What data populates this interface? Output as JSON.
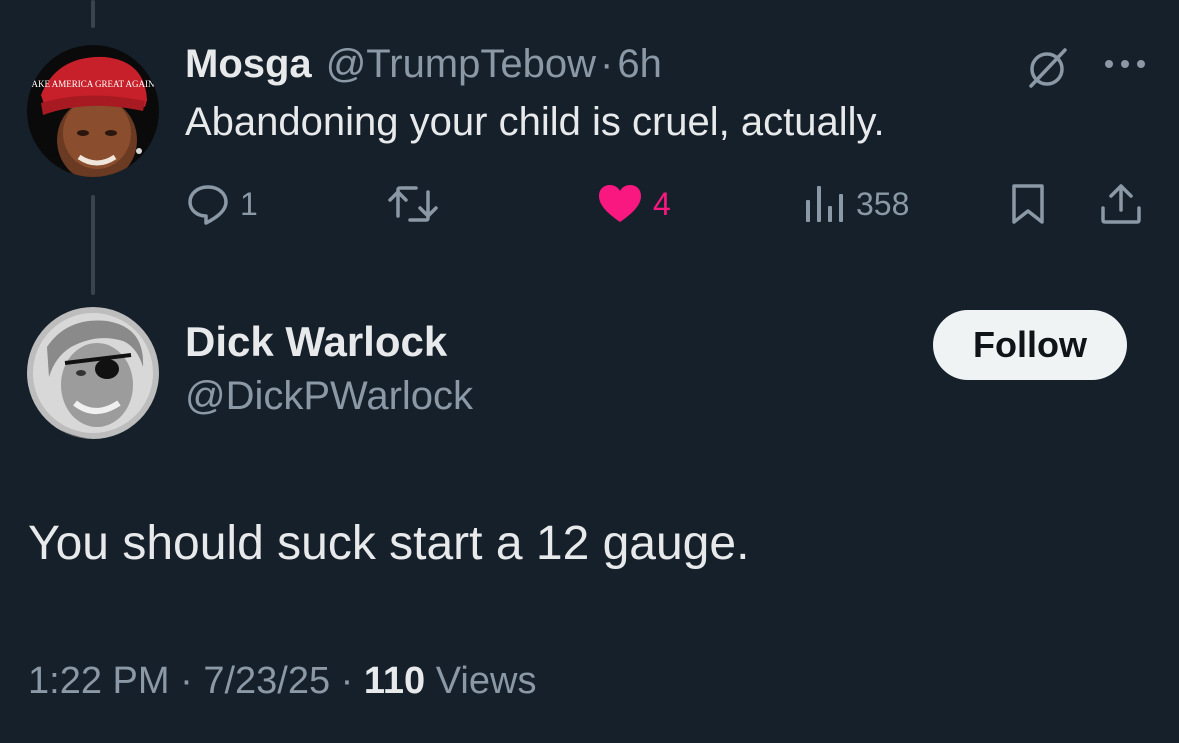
{
  "parent_tweet": {
    "author_name": "Mosga",
    "author_handle": "@TrumpTebow",
    "separator": "·",
    "time": "6h",
    "text": "Abandoning your child is cruel, actually.",
    "hat_text": "MAKE AMERICA GREAT AGAIN",
    "actions": {
      "replies": "1",
      "reposts": "",
      "likes": "4",
      "views": "358"
    },
    "icons": [
      "grok-icon",
      "more-icon",
      "reply-icon",
      "retweet-icon",
      "heart-icon",
      "views-icon",
      "bookmark-icon",
      "share-icon"
    ],
    "like_color": "#f91880"
  },
  "reply_tweet": {
    "author_name": "Dick Warlock",
    "author_handle": "@DickPWarlock",
    "follow_label": "Follow",
    "text": "You should suck start a 12 gauge.",
    "time": "1:22 PM",
    "separator": "·",
    "date": "7/23/25",
    "views_count": "110",
    "views_label": "Views"
  },
  "colors": {
    "background": "#15202b",
    "primary_text": "#e7e9ea",
    "secondary_text": "#8b98a5",
    "thread_line": "#38444d",
    "follow_button_bg": "#eff3f4",
    "like_accent": "#f91880"
  }
}
